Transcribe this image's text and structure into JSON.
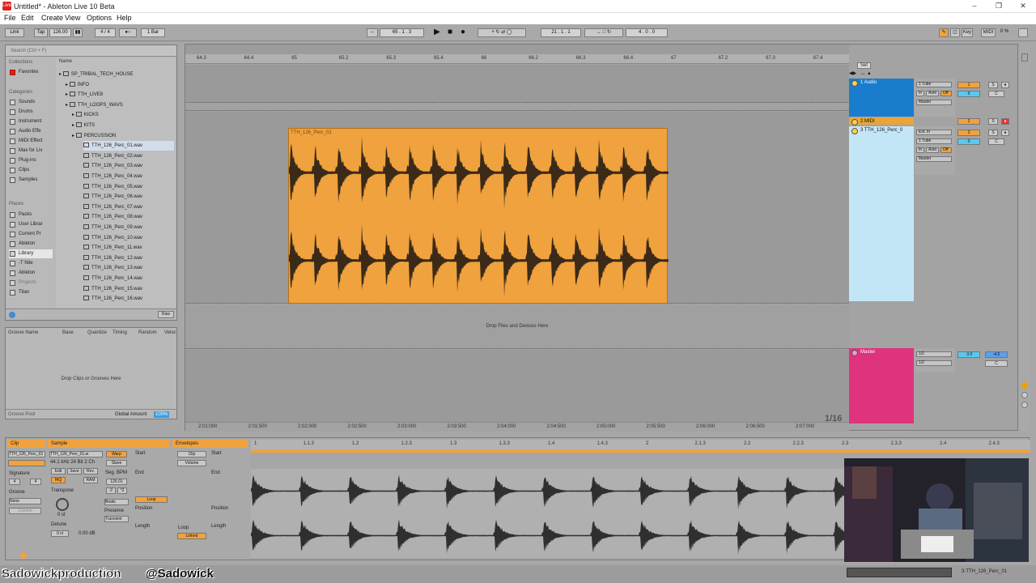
{
  "window": {
    "title": "Untitled* - Ableton Live 10 Beta"
  },
  "menu": [
    "File",
    "Edit",
    "Create",
    "View",
    "Options",
    "Help"
  ],
  "control": {
    "link": "Link",
    "tap": "Tap",
    "bpm": "126.00",
    "sig": "4 / 4",
    "quant": "1 Bar",
    "pos": "65 . 1 . 3",
    "loopstart": "21 . 1 . 1",
    "looplen": "4 . 0 . 0",
    "key": "Key",
    "midi": "MIDI",
    "cpu": "0 %"
  },
  "browser": {
    "search": "Search (Ctrl + F)",
    "collections_hd": "Collections",
    "favorites": "Favorites",
    "categories_hd": "Categories",
    "categories": [
      "Sounds",
      "Drums",
      "Instrument",
      "Audio Effe",
      "MIDI Effect",
      "Max for Liv",
      "Plug-ins",
      "Clips",
      "Samples"
    ],
    "places_hd": "Places",
    "places": [
      "Packs",
      "User Librar",
      "Current Pr",
      "Ableton",
      "Library",
      "-T Nile",
      "Ableton",
      "Projects",
      "Titan"
    ],
    "name_hd": "Name",
    "folders": [
      "SP_TRIBAL_TECH_HOUSE",
      "INFO",
      "TTH_LIVE8",
      "TTH_LOOPS_WAVS",
      "KICKS",
      "KITS",
      "PERCUSSION"
    ],
    "files": [
      "TTH_126_Perc_01.wav",
      "TTH_126_Perc_02.wav",
      "TTH_126_Perc_03.wav",
      "TTH_126_Perc_04.wav",
      "TTH_126_Perc_05.wav",
      "TTH_126_Perc_06.wav",
      "TTH_126_Perc_07.wav",
      "TTH_126_Perc_08.wav",
      "TTH_126_Perc_09.wav",
      "TTH_126_Perc_10.wav",
      "TTH_126_Perc_11.wav",
      "TTH_126_Perc_12.wav",
      "TTH_126_Perc_13.wav",
      "TTH_126_Perc_14.wav",
      "TTH_126_Perc_15.wav",
      "TTH_126_Perc_16.wav"
    ],
    "raw": "Raw"
  },
  "groove": {
    "cols": [
      "Groove Name",
      "Base",
      "Quantize",
      "Timing",
      "Random",
      "Veloc"
    ],
    "drop": "Drop Clips or Grooves Here",
    "pool": "Groove Pool",
    "global": "Global Amount",
    "global_val": "100%"
  },
  "arrangement": {
    "ruler": [
      "64.3",
      "64.4",
      "65",
      "65.2",
      "65.3",
      "65.4",
      "66",
      "66.2",
      "66.3",
      "66.4",
      "67",
      "67.2",
      "67.3",
      "67.4"
    ],
    "time": [
      "2:01:000",
      "2:01:500",
      "2:02:000",
      "2:02:500",
      "2:03:000",
      "2:03:500",
      "2:04:000",
      "2:04:500",
      "2:05:000",
      "2:05:500",
      "2:06:000",
      "2:06:500",
      "2:07:000"
    ],
    "clip_name": "TTH_126_Perc_01",
    "drop": "Drop Files and Devices Here",
    "zoom": "1/16",
    "set": "Set"
  },
  "tracks": [
    {
      "name": "1 Audio",
      "color": "#1a7ccd",
      "input": "1 Tube",
      "num": "1",
      "vol": "0",
      "pan": "C",
      "s": "S"
    },
    {
      "name": "2 MIDI",
      "color": "#e9a43a",
      "num": "2",
      "s": "S"
    },
    {
      "name": "3 TTH_126_Perc_0",
      "color": "#c3e6f7",
      "input": "Ext. In",
      "sub": "1 Tube",
      "num": "3",
      "vol": "0",
      "pan": "C",
      "s": "S"
    },
    {
      "name": "Master",
      "color": "#e0337d",
      "input": "1/2",
      "sub": "1/2",
      "vol": "-3.0",
      "vol2": "-4.0",
      "pan": "C"
    }
  ],
  "io_labels": {
    "in": "In",
    "auto": "Auto",
    "off": "Off",
    "master": "Master"
  },
  "detail": {
    "clip_hd": "Clip",
    "sample_hd": "Sample",
    "env_hd": "Envelopes",
    "clip_name": "TTH_126_Perc_01",
    "sample_name": "TTH_126_Perc_01.w",
    "sample_info": "44.1 kHz 24 Bit 2 Ch",
    "edit": "Edit",
    "save": "Save",
    "rev": "Rev.",
    "hiq": "HiQ",
    "ram": "RAM",
    "signature": "Signature",
    "sig_n": "4",
    "sig_d": "4",
    "groove": "Groove",
    "groove_val": "None",
    "commit": "Commit",
    "warp": "Warp",
    "slave": "Slave",
    "seg_bpm": "Seg. BPM",
    "bpm": "126.01",
    "half": ":2",
    "dbl": "*2",
    "beats": "Beats",
    "preserve": "Preserve",
    "transients": "Transient",
    "transpose": "Transpose",
    "st": "0 st",
    "detune": "Detune",
    "ct": "0 ct",
    "gain": "0.00 dB",
    "start": "Start",
    "end": "End",
    "loop": "Loop",
    "position": "Position",
    "length": "Length",
    "linked": "Linked",
    "env_clip": "Clip",
    "env_vol": "Volume",
    "ruler": [
      "1",
      "1.1.3",
      "1.2",
      "1.2.3",
      "1.3",
      "1.3.3",
      "1.4",
      "1.4.3",
      "2",
      "2.1.3",
      "2.2",
      "2.2.3",
      "2.3",
      "2.3.3",
      "2.4",
      "2.4.3"
    ]
  },
  "footer": {
    "channel": "Sadowickproduction",
    "twitter": "@Sadowick",
    "status": "3-TTH_126_Perc_01"
  }
}
